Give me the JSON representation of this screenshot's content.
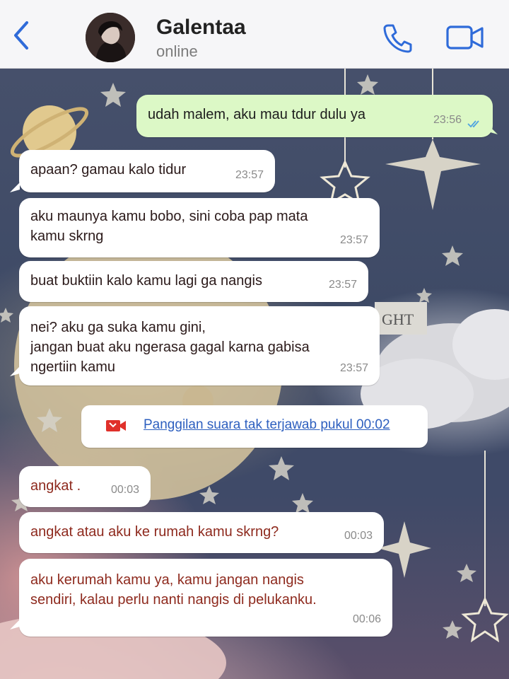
{
  "header": {
    "title": "Galentaa",
    "status": "online"
  },
  "wallpaper": {
    "sign_text": "GHT"
  },
  "messages": [
    {
      "direction": "out",
      "text": "udah malem, aku mau tdur dulu ya",
      "time": "23:56",
      "read": true
    },
    {
      "direction": "in",
      "text": "apaan? gamau kalo tidur",
      "time": "23:57"
    },
    {
      "direction": "in",
      "line1": "aku maunya kamu bobo, sini coba pap mata",
      "line2": "kamu skrng",
      "time": "23:57"
    },
    {
      "direction": "in",
      "text": "buat buktiin kalo kamu lagi ga nangis",
      "time": "23:57"
    },
    {
      "direction": "in",
      "line1": "nei? aku ga suka kamu gini,",
      "line2": "jangan buat aku ngerasa gagal karna gabisa",
      "line3": "ngertiin kamu",
      "time": "23:57"
    },
    {
      "direction": "in",
      "text": "angkat .",
      "time": "00:03"
    },
    {
      "direction": "in",
      "text": "angkat atau aku ke rumah kamu skrng?",
      "time": "00:03"
    },
    {
      "direction": "in",
      "line1": "aku kerumah kamu ya, kamu jangan nangis",
      "line2": "sendiri, kalau perlu nanti nangis di pelukanku.",
      "time": "00:06"
    }
  ],
  "missed_call": {
    "text": "Panggilan suara tak terjawab pukul 00:02",
    "icon": "missed-video-call-icon",
    "icon_color": "#e0302a"
  },
  "colors": {
    "accent": "#2f6bd9",
    "outgoing_bubble": "#dcf8c6",
    "incoming_bubble": "#ffffff",
    "read_ticks": "#4fa3e0"
  }
}
